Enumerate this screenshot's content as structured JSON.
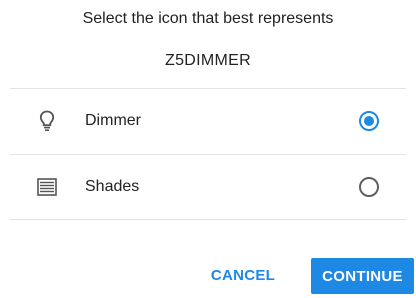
{
  "dialog": {
    "title": "Select the icon that best represents",
    "device_name": "Z5DIMMER"
  },
  "options": [
    {
      "label": "Dimmer",
      "icon": "lightbulb-icon",
      "selected": true
    },
    {
      "label": "Shades",
      "icon": "window-shades-icon",
      "selected": false
    }
  ],
  "buttons": {
    "cancel_label": "CANCEL",
    "continue_label": "CONTINUE"
  },
  "colors": {
    "accent": "#1e88e5",
    "text": "#222222",
    "divider": "#e2e2e2"
  }
}
